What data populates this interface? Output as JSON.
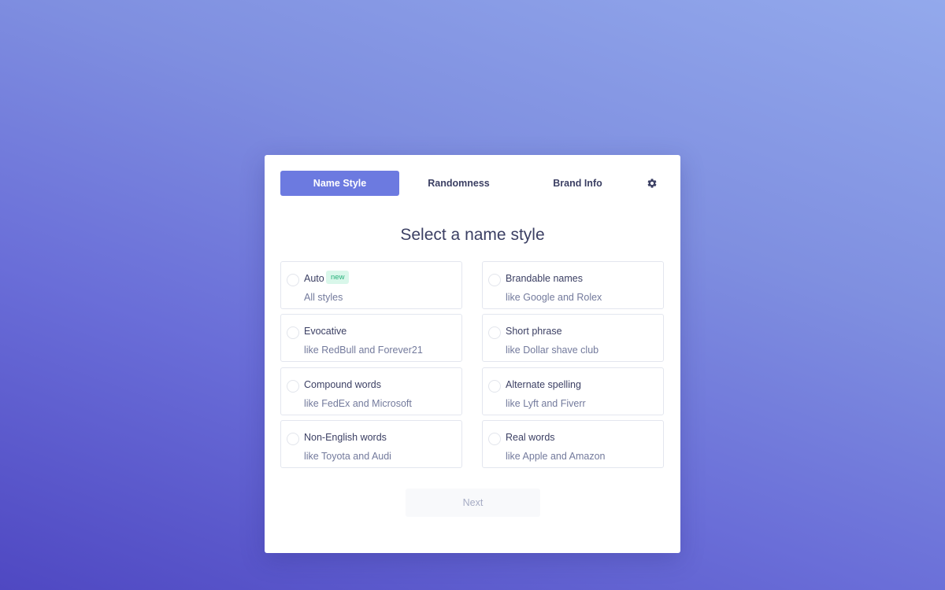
{
  "tabs": [
    {
      "label": "Name Style",
      "active": true
    },
    {
      "label": "Randomness",
      "active": false
    },
    {
      "label": "Brand Info",
      "active": false
    }
  ],
  "settings_icon": "gear-icon",
  "heading": "Select a name style",
  "options": [
    {
      "label": "Auto",
      "badge": "new",
      "desc": "All styles"
    },
    {
      "label": "Brandable names",
      "desc": "like Google and Rolex"
    },
    {
      "label": "Evocative",
      "desc": "like RedBull and Forever21"
    },
    {
      "label": "Short phrase",
      "desc": "like Dollar shave club"
    },
    {
      "label": "Compound words",
      "desc": "like FedEx and Microsoft"
    },
    {
      "label": "Alternate spelling",
      "desc": "like Lyft and Fiverr"
    },
    {
      "label": "Non-English words",
      "desc": "like Toyota and Audi"
    },
    {
      "label": "Real words",
      "desc": "like Apple and Amazon"
    }
  ],
  "next_label": "Next",
  "colors": {
    "accent": "#6c7ae0",
    "badge_text": "#27b07a",
    "badge_bg": "#d9f7ea"
  }
}
